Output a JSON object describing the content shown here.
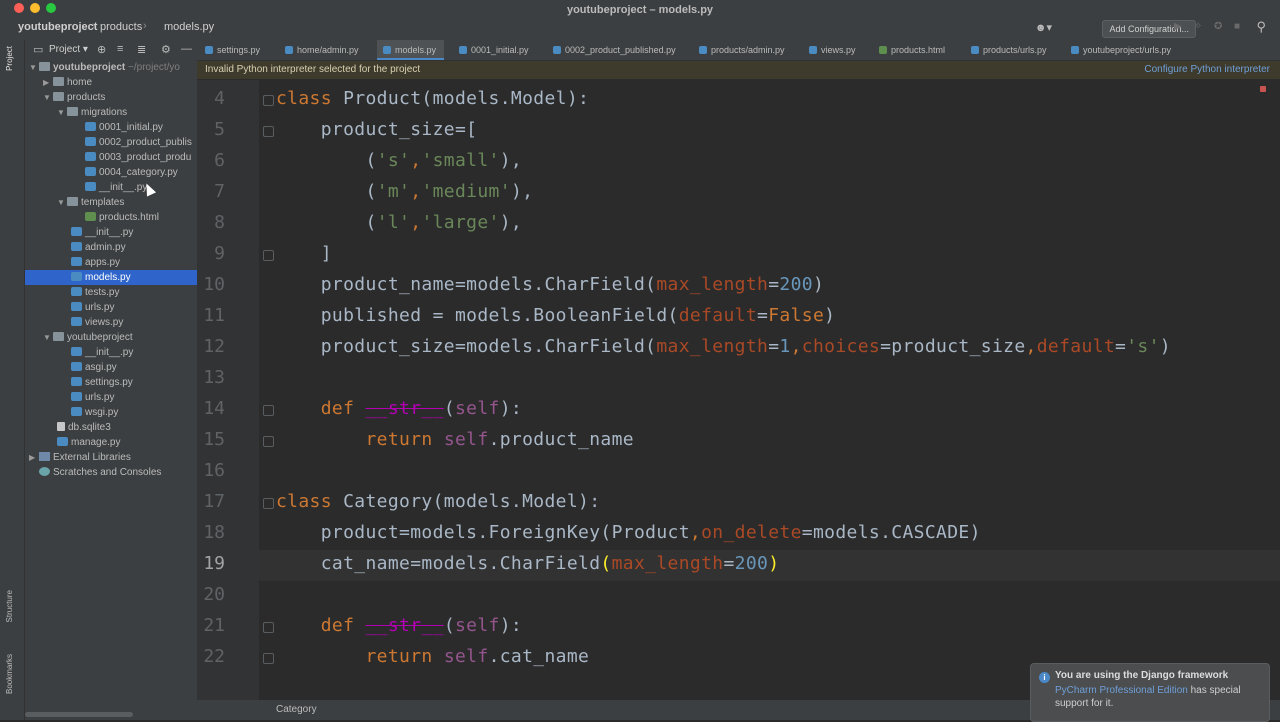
{
  "window": {
    "title": "youtubeproject – models.py"
  },
  "navbar": {
    "breadcrumbs": [
      "youtubeproject",
      "products",
      "models.py"
    ],
    "add_configuration": "Add Configuration..."
  },
  "left_strip": {
    "project_label": "Project",
    "structure_label": "Structure",
    "bookmarks_label": "Bookmarks"
  },
  "project_panel": {
    "title": "Project",
    "root_name": "youtubeproject",
    "root_path": "~/project/yo",
    "items": [
      "home",
      "products",
      "migrations",
      "0001_initial.py",
      "0002_product_publis",
      "0003_product_produ",
      "0004_category.py",
      "__init__.py",
      "templates",
      "products.html",
      "__init__.py",
      "admin.py",
      "apps.py",
      "models.py",
      "tests.py",
      "urls.py",
      "views.py",
      "youtubeproject",
      "__init__.py",
      "asgi.py",
      "settings.py",
      "urls.py",
      "wsgi.py",
      "db.sqlite3",
      "manage.py",
      "External Libraries",
      "Scratches and Consoles"
    ]
  },
  "tabs": [
    "settings.py",
    "home/admin.py",
    "models.py",
    "0001_initial.py",
    "0002_product_published.py",
    "products/admin.py",
    "views.py",
    "products.html",
    "products/urls.py",
    "youtubeproject/urls.py"
  ],
  "warning": {
    "message": "Invalid Python interpreter selected for the project",
    "action": "Configure Python interpreter"
  },
  "editor": {
    "line_numbers": [
      "4",
      "5",
      "6",
      "7",
      "8",
      "9",
      "10",
      "11",
      "12",
      "13",
      "14",
      "15",
      "16",
      "17",
      "18",
      "19",
      "20",
      "21",
      "22"
    ],
    "current_line": "19",
    "lines": [
      [
        [
          "kw",
          "class "
        ],
        [
          "",
          "Product(models.Model):"
        ]
      ],
      [
        [
          "",
          "    product_size=["
        ]
      ],
      [
        [
          "",
          "        ("
        ],
        [
          "str",
          "'s'"
        ],
        [
          "kw",
          ","
        ],
        [
          "str",
          "'small'"
        ],
        [
          "",
          "),"
        ]
      ],
      [
        [
          "",
          "        ("
        ],
        [
          "str",
          "'m'"
        ],
        [
          "kw",
          ","
        ],
        [
          "str",
          "'medium'"
        ],
        [
          "",
          "),"
        ]
      ],
      [
        [
          "",
          "        ("
        ],
        [
          "str",
          "'l'"
        ],
        [
          "kw",
          ","
        ],
        [
          "str",
          "'large'"
        ],
        [
          "",
          "),"
        ]
      ],
      [
        [
          "",
          "    ]"
        ]
      ],
      [
        [
          "",
          "    product_name=models.CharField("
        ],
        [
          "param",
          "max_length"
        ],
        [
          "",
          "="
        ],
        [
          "num",
          "200"
        ],
        [
          "",
          ")"
        ]
      ],
      [
        [
          "",
          "    published = models.BooleanField("
        ],
        [
          "param",
          "default"
        ],
        [
          "",
          "="
        ],
        [
          "kw",
          "False"
        ],
        [
          "",
          ")"
        ]
      ],
      [
        [
          "",
          "    product_size=models.CharField("
        ],
        [
          "param",
          "max_length"
        ],
        [
          "",
          "="
        ],
        [
          "num",
          "1"
        ],
        [
          "kw",
          ","
        ],
        [
          "param",
          "choices"
        ],
        [
          "",
          "=product_size"
        ],
        [
          "kw",
          ","
        ],
        [
          "param",
          "default"
        ],
        [
          "",
          "="
        ],
        [
          "str",
          "'s'"
        ],
        [
          "",
          ")"
        ]
      ],
      [],
      [
        [
          "",
          "    "
        ],
        [
          "kw",
          "def "
        ],
        [
          "dunder",
          "__str__"
        ],
        [
          "",
          "("
        ],
        [
          "self",
          "self"
        ],
        [
          "",
          "):"
        ]
      ],
      [
        [
          "",
          "        "
        ],
        [
          "kw",
          "return "
        ],
        [
          "self",
          "self"
        ],
        [
          "",
          ".product_name"
        ]
      ],
      [],
      [
        [
          "kw",
          "class "
        ],
        [
          "",
          "Category(models.Model):"
        ]
      ],
      [
        [
          "",
          "    product=models.ForeignKey(Product"
        ],
        [
          "kw",
          ","
        ],
        [
          "param",
          "on_delete"
        ],
        [
          "",
          "=models.CASCADE)"
        ]
      ],
      [
        [
          "",
          "    cat_name=models.CharField"
        ],
        [
          "brace",
          "("
        ],
        [
          "param",
          "max_length"
        ],
        [
          "",
          "="
        ],
        [
          "num",
          "200"
        ],
        [
          "brace",
          ")"
        ]
      ],
      [],
      [
        [
          "",
          "    "
        ],
        [
          "kw",
          "def "
        ],
        [
          "dunder",
          "__str__"
        ],
        [
          "",
          "("
        ],
        [
          "self",
          "self"
        ],
        [
          "",
          "):"
        ]
      ],
      [
        [
          "",
          "        "
        ],
        [
          "kw",
          "return "
        ],
        [
          "self",
          "self"
        ],
        [
          "",
          ".cat_name"
        ]
      ]
    ]
  },
  "status": {
    "breadcrumb": "Category"
  },
  "notification": {
    "title": "You are using the Django framework",
    "link_text": "PyCharm Professional Edition",
    "rest_text": " has special support for it."
  }
}
